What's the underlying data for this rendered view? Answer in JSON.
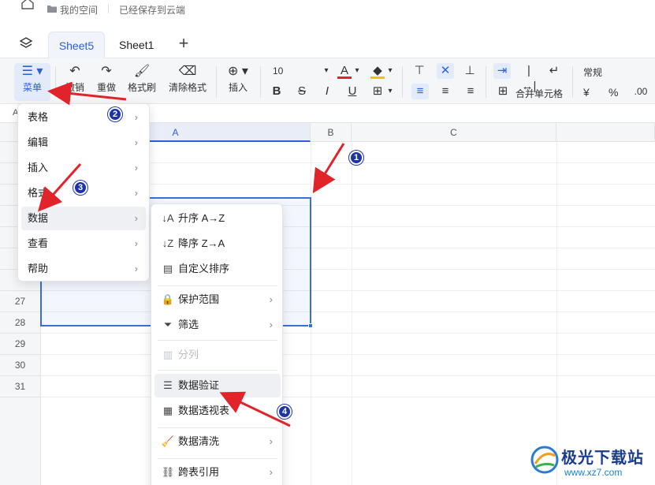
{
  "topbar": {
    "breadcrumb": "我的空间",
    "save_status": "已经保存到云端"
  },
  "sheets": {
    "tabs": [
      "Sheet5",
      "Sheet1"
    ],
    "add": "+"
  },
  "toolbar": {
    "menu": "菜单",
    "undo": "撤销",
    "redo": "重做",
    "format_painter": "格式刷",
    "clear_format": "清除格式",
    "insert": "插入",
    "font_size": "10",
    "merge_cells": "合并单元格",
    "number_format": "常规",
    "currency": "¥",
    "percent": "%"
  },
  "grid": {
    "columns": [
      "A",
      "B",
      "C"
    ],
    "rows": [
      "27",
      "28",
      "29",
      "30",
      "31"
    ]
  },
  "main_menu": {
    "items": [
      "表格",
      "编辑",
      "插入",
      "格式",
      "数据",
      "查看",
      "帮助"
    ]
  },
  "data_submenu": {
    "items": [
      {
        "label": "升序 A→Z",
        "icon": "sort-asc-icon"
      },
      {
        "label": "降序 Z→A",
        "icon": "sort-desc-icon"
      },
      {
        "label": "自定义排序",
        "icon": "custom-sort-icon"
      },
      {
        "label": "保护范围",
        "icon": "lock-icon"
      },
      {
        "label": "筛选",
        "icon": "filter-icon"
      },
      {
        "label": "分列",
        "icon": "split-column-icon"
      },
      {
        "label": "数据验证",
        "icon": "data-validation-icon"
      },
      {
        "label": "数据透视表",
        "icon": "pivot-table-icon"
      },
      {
        "label": "数据清洗",
        "icon": "data-clean-icon"
      },
      {
        "label": "跨表引用",
        "icon": "link-icon"
      }
    ]
  },
  "annotations": {
    "steps": [
      "1",
      "2",
      "3",
      "4"
    ],
    "arrow_color": "#e0242a",
    "badge_color": "#1d33a8"
  },
  "watermark": {
    "title": "极光下载站",
    "url": "www.xz7.com"
  },
  "colors": {
    "accent": "#2d5fd6",
    "selection": "#3b6fd8"
  }
}
